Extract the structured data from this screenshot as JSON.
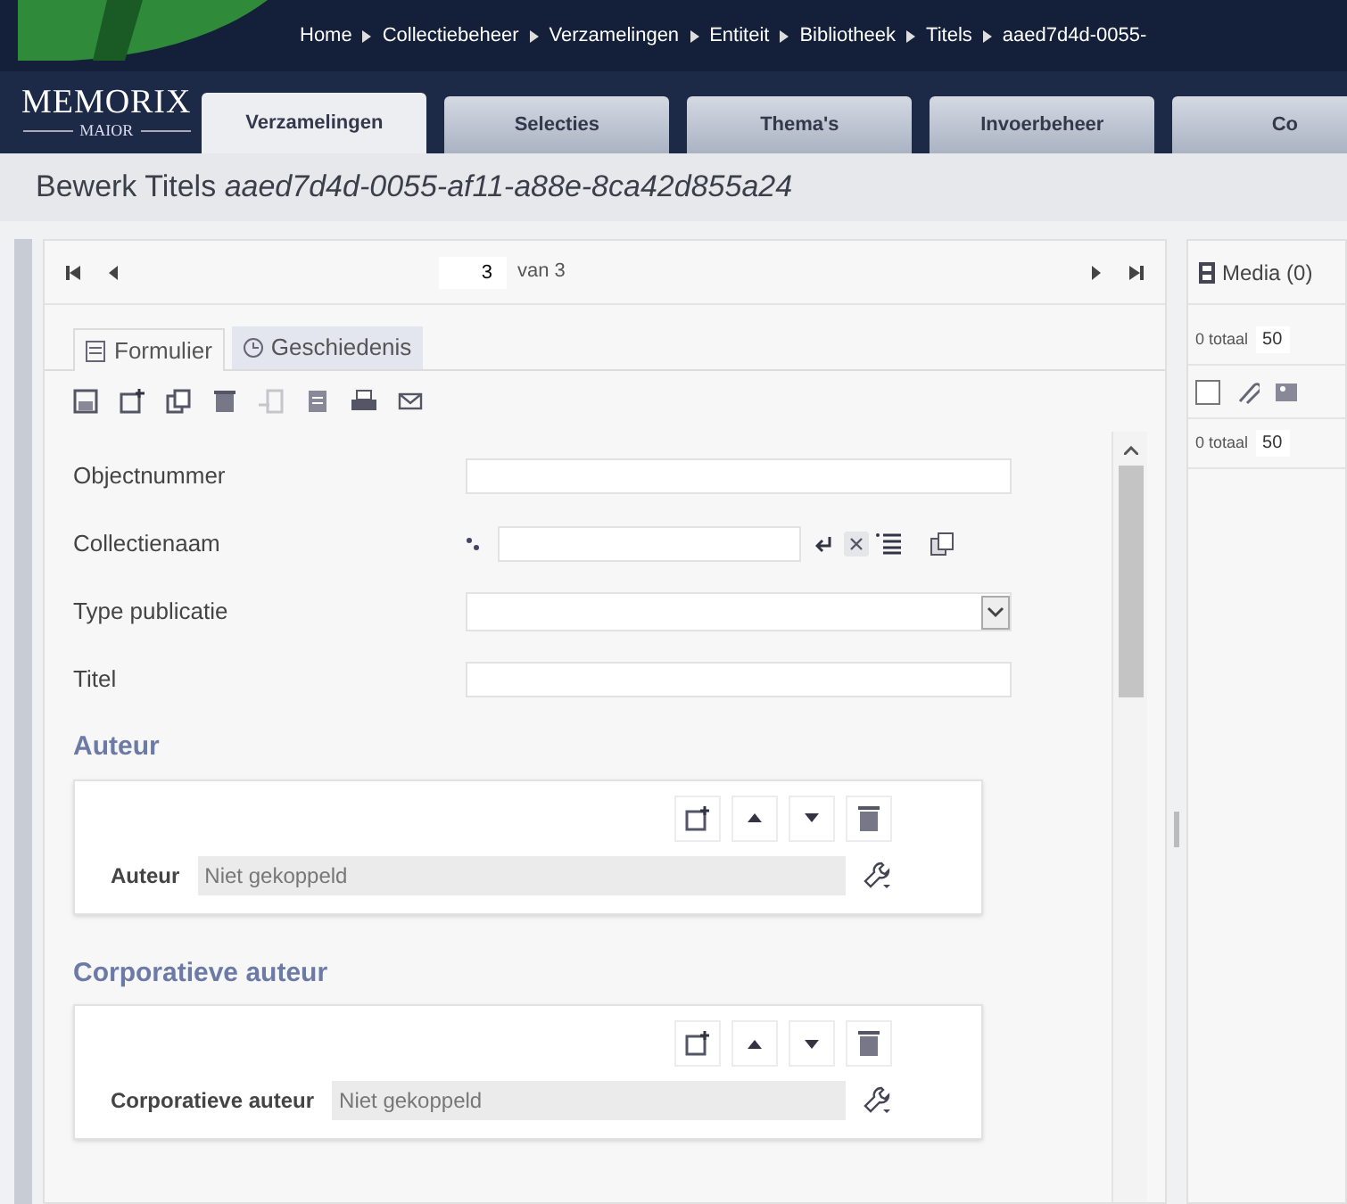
{
  "breadcrumb": [
    "Home",
    "Collectiebeheer",
    "Verzamelingen",
    "Entiteit",
    "Bibliotheek",
    "Titels",
    "aaed7d4d-0055-"
  ],
  "logo": {
    "name": "MEMORIX",
    "sub": "MAIOR"
  },
  "tabs": [
    {
      "label": "Verzamelingen",
      "selected": true
    },
    {
      "label": "Selecties",
      "selected": false
    },
    {
      "label": "Thema's",
      "selected": false
    },
    {
      "label": "Invoerbeheer",
      "selected": false
    },
    {
      "label": "Co",
      "selected": false
    }
  ],
  "title": {
    "prefix": "Bewerk Titels",
    "id": "aaed7d4d-0055-af11-a88e-8ca42d855a24"
  },
  "pager": {
    "current": "3",
    "total": "van 3"
  },
  "form_tabs": [
    {
      "label": "Formulier",
      "kind": "form",
      "selected": true
    },
    {
      "label": "Geschiedenis",
      "kind": "history",
      "selected": false
    }
  ],
  "toolbar": [
    {
      "kind": "save",
      "disabled": false
    },
    {
      "kind": "new",
      "disabled": false
    },
    {
      "kind": "copy",
      "disabled": false
    },
    {
      "kind": "delete",
      "disabled": false
    },
    {
      "kind": "export",
      "disabled": true
    },
    {
      "kind": "note",
      "disabled": false
    },
    {
      "kind": "print",
      "disabled": false
    },
    {
      "kind": "mail",
      "disabled": false
    }
  ],
  "fields": [
    {
      "label": "Objectnummer",
      "kind": "text"
    },
    {
      "label": "Collectienaam",
      "kind": "lookup"
    },
    {
      "label": "Type publicatie",
      "kind": "select"
    },
    {
      "label": "Titel",
      "kind": "text"
    }
  ],
  "sections": [
    {
      "heading": "Auteur",
      "label": "Auteur",
      "value": "Niet gekoppeld"
    },
    {
      "heading": "Corporatieve auteur",
      "label": "Corporatieve auteur",
      "value": "Niet gekoppeld"
    }
  ],
  "media": {
    "title": "Media (0)",
    "rows": [
      {
        "count": "0 totaal",
        "size": "50"
      },
      {
        "count": "0 totaal",
        "size": "50"
      }
    ]
  }
}
